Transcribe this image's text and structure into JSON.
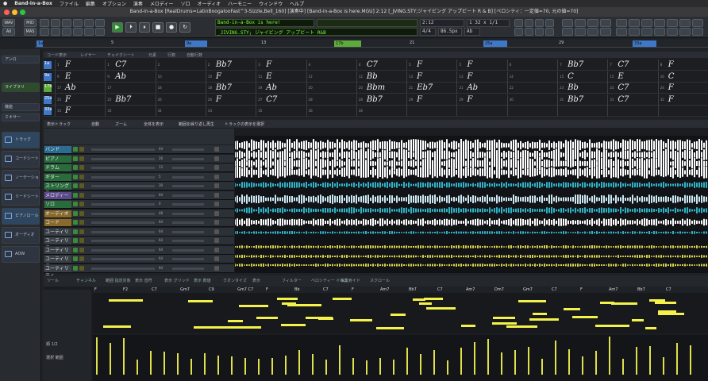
{
  "menubar": {
    "app": "Band-in-a-Box",
    "items": [
      "ファイル",
      "編集",
      "オプション",
      "演奏",
      "メロディー",
      "ソロ",
      "オーディオ",
      "ハーモニー",
      "ウィンドウ",
      "ヘルプ"
    ]
  },
  "title": "Band-in-a-Box [RealDrums=LatinBoogalooFast^3-Sizzle,Bell_160] [演奏中] [Band-in-a-Box is here.MGU]  2:12 [_JVING.STY;ジャイビング アップビート R & B] [ベロシティ：一定値=70, 元の値=70]",
  "toolbar": {
    "wav": "WAV",
    "mid": "MID",
    "all": "All",
    "mas": "MAS",
    "lcd1": "Band-in-a-Box is here!",
    "lcd2": "_JIVING.STY; ジャイビング アップビート R&B",
    "time": "2:12",
    "bpm": "86.5px",
    "bar": "4/4",
    "key": "Ab",
    "pos": "1  32  x 1/1"
  },
  "timeline": {
    "numbers": [
      "5",
      "9",
      "13",
      "17",
      "21",
      "25",
      "29",
      "33"
    ],
    "parts": [
      "1a",
      "9a",
      "17b",
      "25a",
      "33a"
    ]
  },
  "chords": {
    "toolbar": [
      "コード表示",
      "レイヤー",
      "チェイクシート",
      "元素",
      "行数",
      "自動行数"
    ],
    "rows": [
      {
        "bar": "1a",
        "cells": [
          "F",
          "C7",
          "",
          "Bb7",
          "F",
          "",
          "C7",
          "F",
          "F",
          "",
          "Bb7",
          "C7",
          "F"
        ]
      },
      {
        "bar": "9a",
        "cells": [
          "E",
          "Ab",
          "",
          "F",
          "E",
          "",
          "Bb",
          "F",
          "F",
          "",
          "C",
          "E",
          "C"
        ]
      },
      {
        "bar": "17b",
        "cells": [
          "Ab",
          "",
          "",
          "Bb7",
          "Ab",
          "",
          "Bbm",
          "Eb7",
          "Ab",
          "",
          "Bb",
          "C7",
          "F"
        ]
      },
      {
        "bar": "25a",
        "cells": [
          "F",
          "Bb7",
          "",
          "F",
          "C7",
          "",
          "Bb7",
          "F",
          "F",
          "",
          "Bb7",
          "C7",
          "F"
        ]
      },
      {
        "bar": "33a",
        "cells": [
          "F",
          "",
          "",
          "",
          "",
          "",
          "",
          "",
          "",
          "",
          "",
          "",
          ""
        ]
      }
    ],
    "nums": [
      "1",
      "2",
      "3",
      "4",
      "5",
      "6",
      "7",
      "8",
      "9",
      "10",
      "11",
      "12",
      "13",
      "14",
      "15",
      "16",
      "17",
      "18",
      "19",
      "20",
      "21",
      "22",
      "23",
      "24",
      "25",
      "26",
      "27",
      "28",
      "29",
      "30",
      "31",
      "32",
      "33",
      "34",
      "35",
      "36"
    ]
  },
  "tracks": {
    "header": [
      "表示トラック",
      "自動",
      "ズーム",
      "全体を表示",
      "範囲を繰り返し再生",
      "トラックの表示を選択"
    ],
    "names": [
      "バンド",
      "ピアノ",
      "ドラム",
      "ギター",
      "ストリングス",
      "メロディー",
      "ソロ",
      "オーディオ",
      "コード",
      "ユーティリティ",
      "ユーティリティ",
      "ユーティリティ",
      "ユーティリティ",
      "ユーティリティ"
    ],
    "vals": [
      "44",
      "26",
      "13",
      "5",
      "30",
      "64",
      "0",
      "48",
      "64",
      "64",
      "64",
      "64",
      "64",
      "64"
    ]
  },
  "sidebar": {
    "preset": "アンロ",
    "library": "ライブラリ",
    "panels": [
      "機能",
      "ミキサー"
    ],
    "views": [
      "トラック",
      "コードシート",
      "ノーテーション",
      "リードシート",
      "ピアノロール",
      "オーディオ",
      "AOW"
    ]
  },
  "pianoroll": {
    "tools": [
      "ツール",
      "チャンネル",
      "範囲 指定対象",
      "表示 音符",
      "表示 グリッド",
      "表示 数値",
      "クオンタイズ",
      "表示",
      "フィルター",
      "ベロシティー イベント",
      "編集ガイド",
      "スクロール"
    ],
    "chords": [
      "F",
      "F2",
      "C7",
      "Gm7",
      "C9",
      "Gm7 C7",
      "F",
      "Bb",
      "C7",
      "F",
      "Am7",
      "Bb7",
      "C7",
      "Am7",
      "Dm7",
      "Gm7",
      "C7",
      "F",
      "Am7",
      "Bb7",
      "C7"
    ],
    "side": [
      "順 1/2",
      "範 2",
      "選択 範囲"
    ]
  },
  "colors": {
    "accent": "#f4f14a",
    "part": "#3f78c8",
    "green": "#3a8a3a"
  }
}
